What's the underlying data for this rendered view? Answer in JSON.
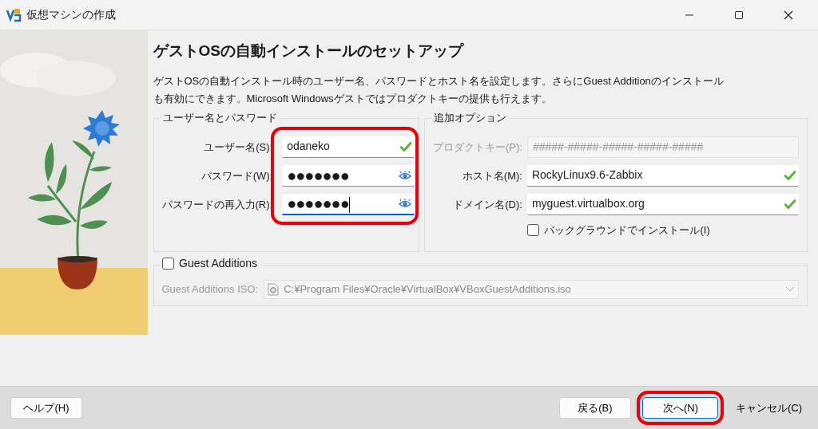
{
  "window": {
    "title": "仮想マシンの作成"
  },
  "heading": "ゲストOSの自動インストールのセットアップ",
  "description": "ゲストOSの自動インストール時のユーザー名、パスワードとホスト名を設定します。さらにGuest Additionのインストールも有効にできます。Microsoft Windowsゲストではプロダクトキーの提供も行えます。",
  "credentials": {
    "title": "ユーザー名とパスワード",
    "highlighted": true,
    "fields": [
      {
        "label": "ユーザー名(S):",
        "value": "odaneko",
        "kind": "valid",
        "focused": false
      },
      {
        "label": "パスワード(W):",
        "value": "●●●●●●●",
        "kind": "password",
        "focused": false
      },
      {
        "label": "パスワードの再入力(R):",
        "value": "●●●●●●●",
        "kind": "password",
        "focused": true
      }
    ]
  },
  "options": {
    "title": "追加オプション",
    "fields": [
      {
        "label": "プロダクトキー(P):",
        "placeholder": "#####-#####-#####-#####-#####",
        "kind": "disabled"
      },
      {
        "label": "ホスト名(M):",
        "value": "RockyLinux9.6-Zabbix",
        "kind": "valid"
      },
      {
        "label": "ドメイン名(D):",
        "value": "myguest.virtualbox.org",
        "kind": "valid"
      }
    ],
    "background_install": {
      "label": "バックグラウンドでインストール(I)",
      "checked": false
    }
  },
  "guest_additions": {
    "label": "Guest Additions",
    "checked": false,
    "iso_label": "Guest Additions ISO:",
    "iso_path": "C:¥Program Files¥Oracle¥VirtualBox¥VBoxGuestAdditions.iso",
    "disabled": true
  },
  "buttons": [
    {
      "label": "ヘルプ(H)",
      "kind": "help",
      "highlighted": false
    },
    {
      "label": "戻る(B)",
      "kind": "nav",
      "highlighted": false
    },
    {
      "label": "次へ(N)",
      "kind": "default",
      "highlighted": true
    },
    {
      "label": "キャンセル(C)",
      "kind": "flat",
      "highlighted": false
    }
  ]
}
